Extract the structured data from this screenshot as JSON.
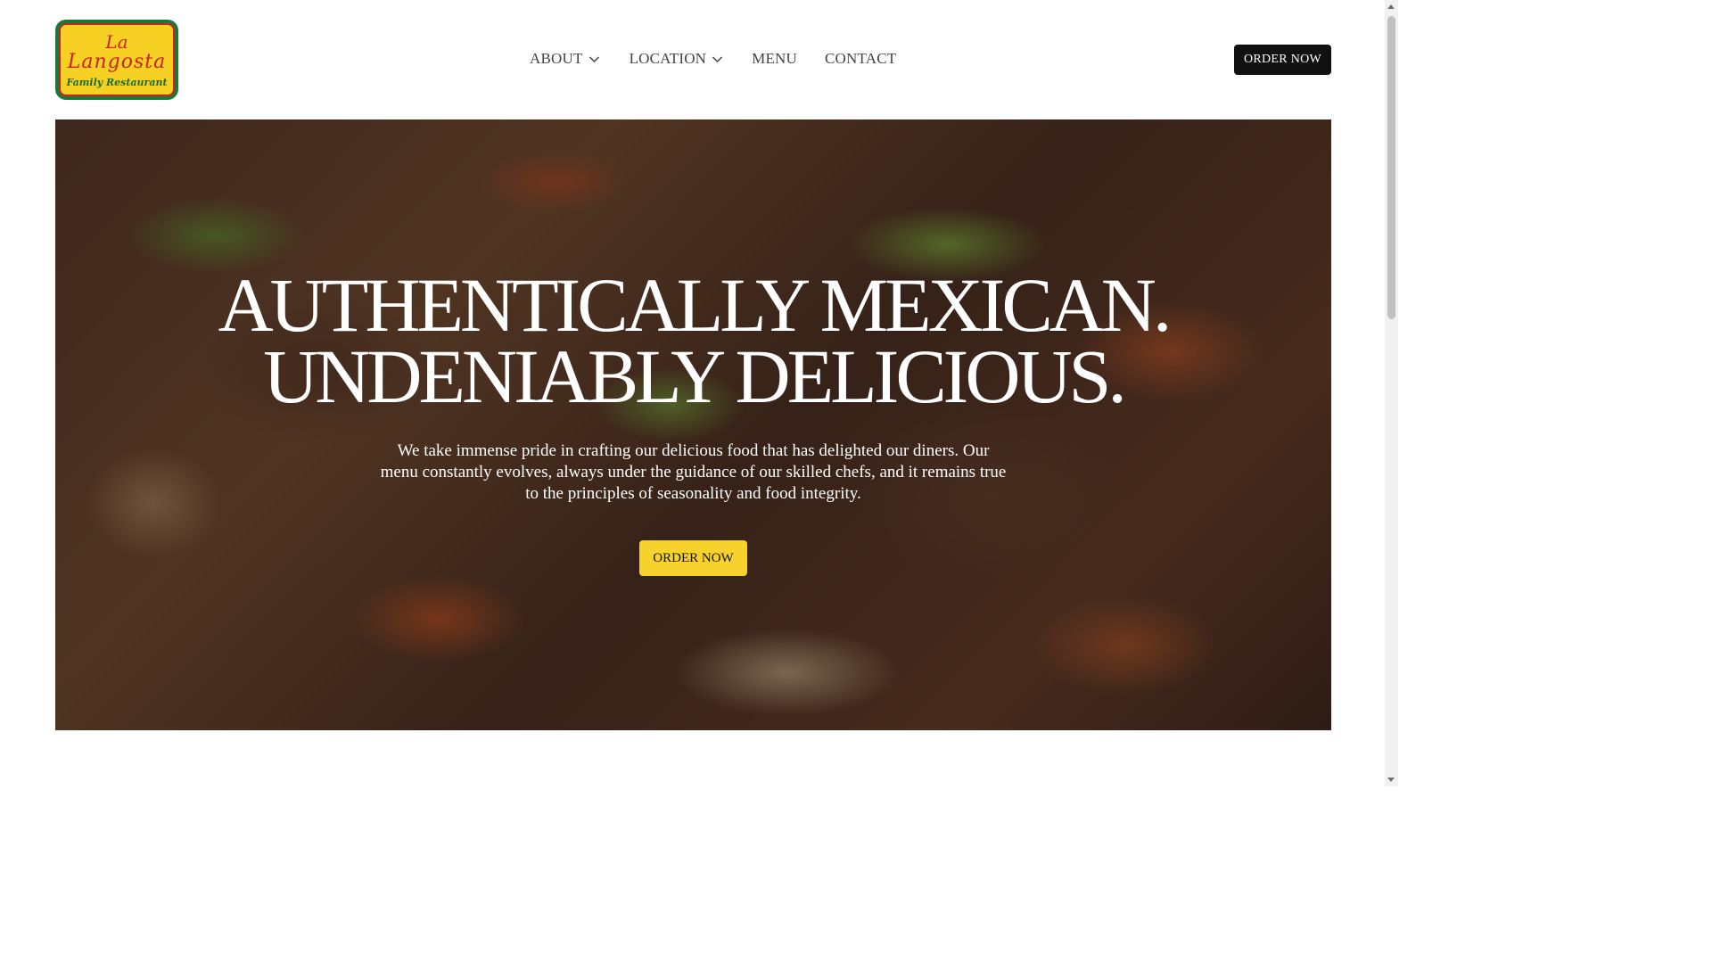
{
  "logo": {
    "line1": "La",
    "line2": "Langosta",
    "line3": "Family Restaurant"
  },
  "nav": {
    "items": [
      {
        "label": "ABOUT",
        "has_dropdown": true,
        "icon": "chevron-down-icon"
      },
      {
        "label": "LOCATION",
        "has_dropdown": true,
        "icon": "chevron-down-icon"
      },
      {
        "label": "MENU",
        "has_dropdown": false
      },
      {
        "label": "CONTACT",
        "has_dropdown": false
      }
    ],
    "order_button": "ORDER NOW"
  },
  "hero": {
    "headline_line1": "AUTHENTICALLY MEXICAN.",
    "headline_line2": "UNDENIABLY DELICIOUS.",
    "description": "We take immense pride in crafting our delicious food that has delighted our diners. Our menu constantly evolves, always under the guidance of our skilled chefs, and it remains true to the principles of seasonality and food integrity.",
    "order_button": "ORDER NOW"
  },
  "colors": {
    "top_button_bg": "#111111",
    "hero_button_bg": "#f8d22c",
    "logo_green": "#1a7a35",
    "logo_yellow": "#f6d022",
    "logo_red": "#c8231f"
  }
}
